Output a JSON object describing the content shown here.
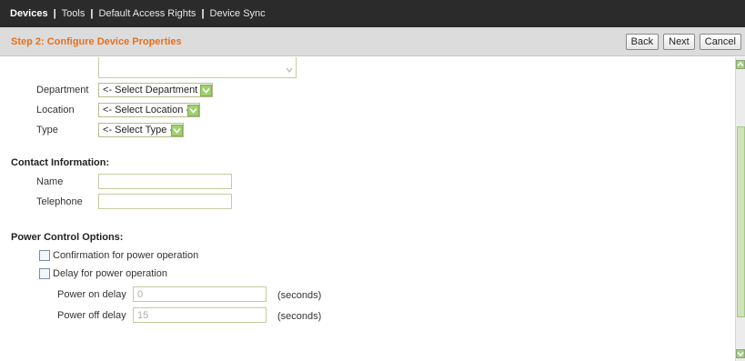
{
  "nav": {
    "items": [
      "Devices",
      "Tools",
      "Default Access Rights",
      "Device Sync"
    ],
    "separator": "|"
  },
  "step": {
    "title": "Step 2: Configure Device Properties",
    "back_label": "Back",
    "next_label": "Next",
    "cancel_label": "Cancel"
  },
  "properties": {
    "department_label": "Department",
    "department_value": "<- Select Department ->",
    "location_label": "Location",
    "location_value": "<- Select Location ->",
    "type_label": "Type",
    "type_value": "<- Select Type ->"
  },
  "contact": {
    "heading": "Contact Information:",
    "name_label": "Name",
    "name_value": "",
    "telephone_label": "Telephone",
    "telephone_value": ""
  },
  "power": {
    "heading": "Power Control Options:",
    "confirmation_label": "Confirmation for power operation",
    "delay_label": "Delay for power operation",
    "on_delay_label": "Power on delay",
    "on_delay_value": "0",
    "off_delay_label": "Power off delay",
    "off_delay_value": "15",
    "seconds_label": "(seconds)"
  },
  "colors": {
    "step_title": "#e8711c",
    "top_bar": "#2b2b2b",
    "dropdown_accent": "#9fd070"
  }
}
